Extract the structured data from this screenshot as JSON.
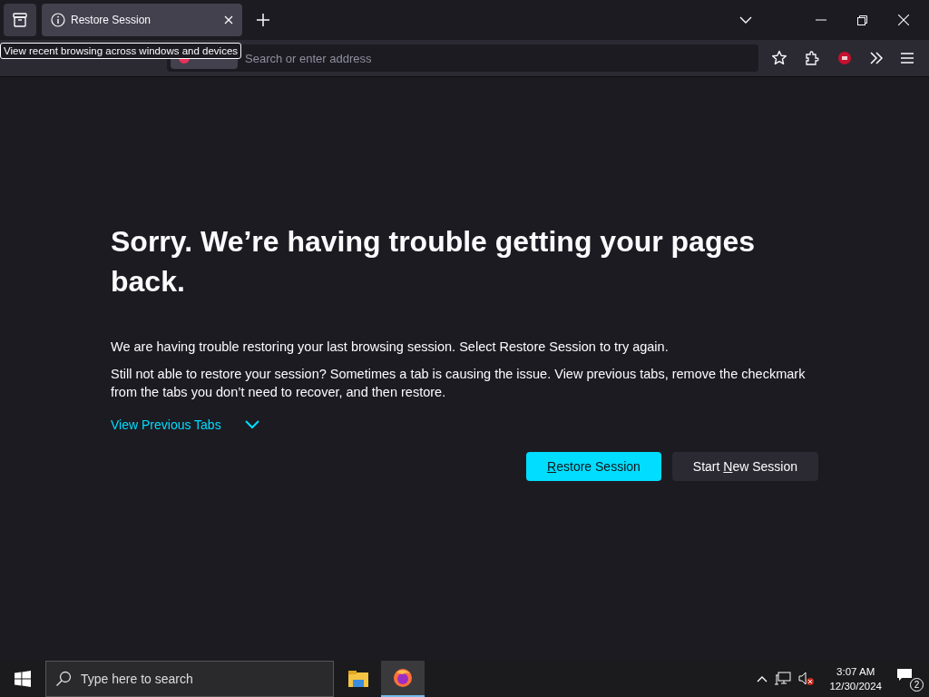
{
  "tabs": [
    {
      "title": "Restore Session",
      "selected": true
    }
  ],
  "tooltip": "View recent browsing across windows and devices",
  "address": {
    "placeholder": "Search or enter address"
  },
  "heading": "Sorry. We’re having trouble getting your pages back.",
  "paragraphs": [
    "We are having trouble restoring your last browsing session. Select Restore Session to try again.",
    "Still not able to restore your session? Sometimes a tab is causing the issue. View previous tabs, remove the checkmark from the tabs you don’t need to recover, and then restore."
  ],
  "toggle": {
    "label": "View Previous Tabs",
    "expanded": false
  },
  "buttons": [
    {
      "key": "R",
      "after": "estore Session",
      "kind": "primary"
    },
    {
      "before": "Start ",
      "key": "N",
      "after": "ew Session",
      "kind": "secondary"
    }
  ],
  "taskbar": {
    "search_placeholder": "Type here to search",
    "time": "3:07 AM",
    "date": "12/30/2024",
    "notifications": "2"
  }
}
